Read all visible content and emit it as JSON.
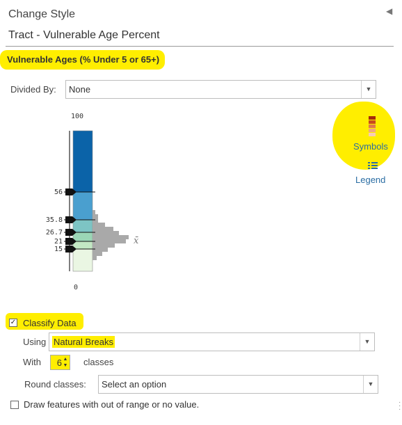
{
  "header": {
    "title": "Change Style",
    "subtitle": "Tract - Vulnerable Age Percent",
    "collapse_icon": "triangle-left-icon"
  },
  "field": {
    "title": "Vulnerable Ages (% Under 5 or 65+)"
  },
  "divided_by": {
    "label": "Divided By:",
    "value": "None"
  },
  "side_links": {
    "symbols_label": "Symbols",
    "legend_label": "Legend",
    "symbols_icon": "color-ramp-icon",
    "legend_icon": "legend-list-icon",
    "ramp_colors": [
      "#a52a0a",
      "#c94a1e",
      "#e07a4c",
      "#f0a882",
      "#f7cdb6"
    ]
  },
  "classification": {
    "max_label": "100",
    "min_label": "0",
    "mean_label": "x̄",
    "breaks": [
      {
        "label": "56",
        "value": 56
      },
      {
        "label": "35.8",
        "value": 35.8
      },
      {
        "label": "26.7",
        "value": 26.7
      },
      {
        "label": "21",
        "value": 21
      },
      {
        "label": "15",
        "value": 15
      }
    ],
    "class_colors": [
      "#0b63a8",
      "#4a9fcf",
      "#7dc4c4",
      "#9bd6b6",
      "#c3e8c4",
      "#eaf6e3"
    ],
    "histogram_color": "#a9a9a9",
    "handle_icon": "break-handle-icon"
  },
  "classify": {
    "checkbox_label": "Classify Data",
    "checked": true,
    "using_label": "Using",
    "method": "Natural Breaks",
    "with_label": "With",
    "num_classes": "6",
    "classes_label": "classes",
    "round_label": "Round classes:",
    "round_placeholder": "Select an option"
  },
  "out_of_range": {
    "label": "Draw features with out of range or no value.",
    "checked": false
  },
  "colors": {
    "highlight": "#ffee00",
    "link": "#2a6da3"
  }
}
